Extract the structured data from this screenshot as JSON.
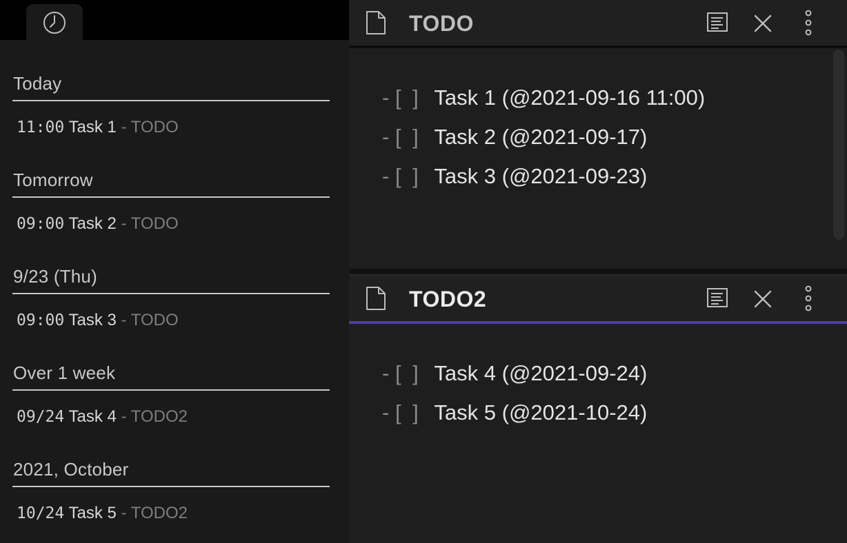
{
  "sidebar": {
    "tab_icon": "clock-icon",
    "groups": [
      {
        "header": "Today",
        "item": {
          "time": "11:00",
          "name": "Task 1",
          "sep": " - ",
          "file": "TODO"
        }
      },
      {
        "header": "Tomorrow",
        "item": {
          "time": "09:00",
          "name": "Task 2",
          "sep": " - ",
          "file": "TODO"
        }
      },
      {
        "header": "9/23 (Thu)",
        "item": {
          "time": "09:00",
          "name": "Task 3",
          "sep": " - ",
          "file": "TODO"
        }
      },
      {
        "header": "Over 1 week",
        "item": {
          "time": "09/24",
          "name": "Task 4",
          "sep": " - ",
          "file": "TODO2"
        }
      },
      {
        "header": "2021, October",
        "item": {
          "time": "10/24",
          "name": "Task 5",
          "sep": " - ",
          "file": "TODO2"
        }
      }
    ]
  },
  "panes": [
    {
      "title": "TODO",
      "active": false,
      "lines": [
        {
          "prefix": "-",
          "box": "[ ]",
          "text": "Task 1 (@2021-09-16 11:00)"
        },
        {
          "prefix": "-",
          "box": "[ ]",
          "text": "Task 2 (@2021-09-17)"
        },
        {
          "prefix": "-",
          "box": "[ ]",
          "text": "Task 3 (@2021-09-23)"
        }
      ]
    },
    {
      "title": "TODO2",
      "active": true,
      "lines": [
        {
          "prefix": "-",
          "box": "[ ]",
          "text": "Task 4 (@2021-09-24)"
        },
        {
          "prefix": "-",
          "box": "[ ]",
          "text": "Task 5 (@2021-10-24)"
        }
      ]
    }
  ],
  "colors": {
    "active_pane_accent": "#4c3fa0",
    "sidebar_bg": "#1a1a1a",
    "pane_bg": "#1e1e1e"
  }
}
